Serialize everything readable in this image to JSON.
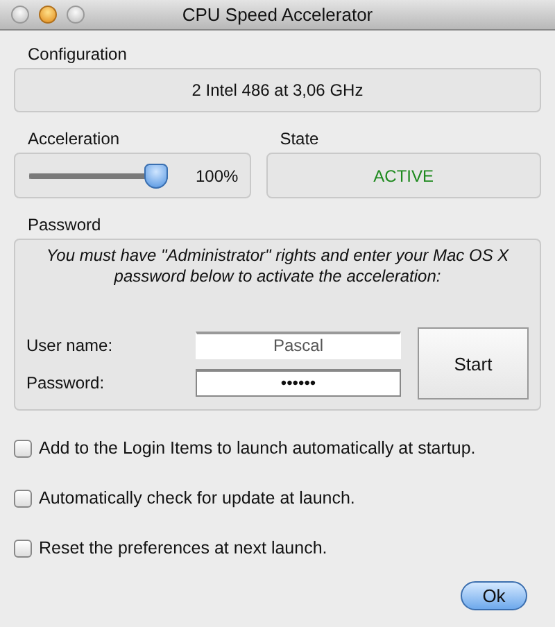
{
  "window": {
    "title": "CPU Speed Accelerator"
  },
  "configuration": {
    "label": "Configuration",
    "value": "2 Intel 486 at 3,06 GHz"
  },
  "acceleration": {
    "label": "Acceleration",
    "level": 1,
    "reading": "100%"
  },
  "state": {
    "label": "State",
    "value": "ACTIVE"
  },
  "password_section": {
    "label": "Password",
    "message": "You must have \"Administrator\" rights and enter your Mac OS X password below to activate the acceleration:",
    "fields": [
      {
        "label": "User name:",
        "value": "Pascal"
      },
      {
        "label": "Password:",
        "value": "••••••"
      }
    ],
    "button": "Start"
  },
  "options": [
    {
      "label": "Add to the Login Items to launch automatically at startup.",
      "checked": false
    },
    {
      "label": "Automatically check for update at launch.",
      "checked": false
    },
    {
      "label": "Reset the preferences at next launch.",
      "checked": false
    }
  ],
  "buttons": [
    "Ok"
  ]
}
